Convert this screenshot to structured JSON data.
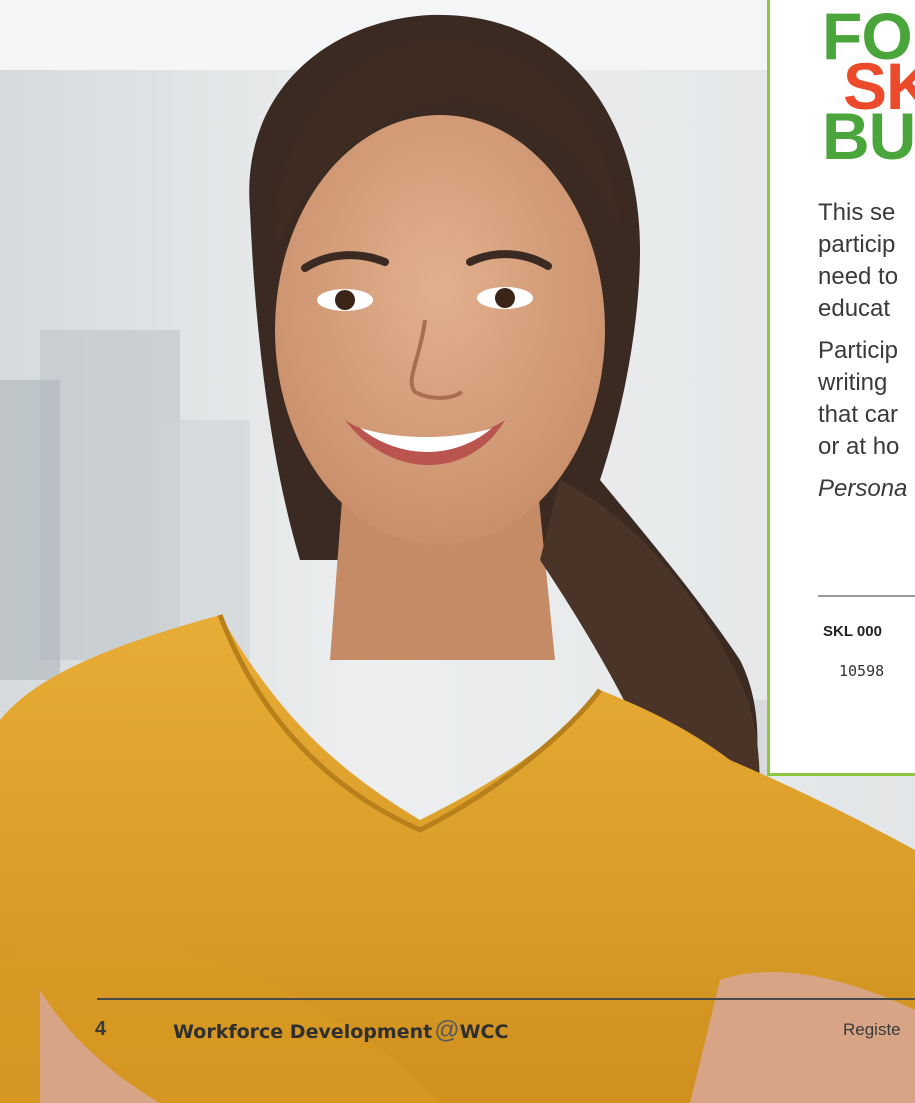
{
  "headline": {
    "line1": "FO",
    "line2": "SK",
    "line3": "BU"
  },
  "description": {
    "para1": [
      "This se",
      "particip",
      "need to",
      "educat"
    ],
    "para2": [
      "Particip",
      "writing",
      "that car",
      "or at ho"
    ],
    "note": "Persona"
  },
  "course": {
    "code": "SKL 000",
    "number": "10598"
  },
  "footer": {
    "page_number": "4",
    "brand_main": "Workforce Development",
    "brand_at": "@",
    "brand_wcc": "WCC",
    "right_text": "Registe"
  },
  "colors": {
    "accent_green": "#4aa53b",
    "accent_red": "#ec4a2a",
    "box_border": "#8dc63f",
    "shirt_yellow": "#e1a42c"
  }
}
